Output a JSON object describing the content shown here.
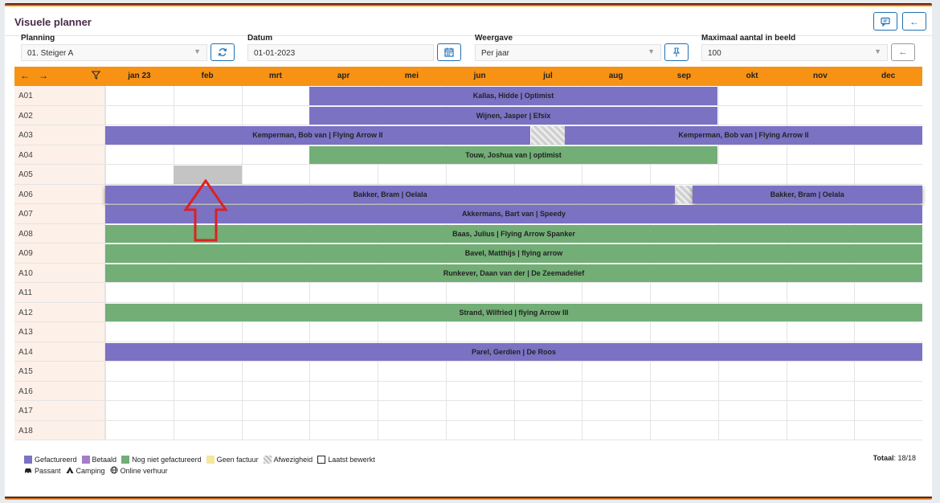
{
  "header": {
    "title": "Visuele planner"
  },
  "filters": {
    "planning": {
      "label": "Planning",
      "value": "01. Steiger A"
    },
    "datum": {
      "label": "Datum",
      "value": "01-01-2023"
    },
    "weergave": {
      "label": "Weergave",
      "value": "Per jaar"
    },
    "max": {
      "label": "Maximaal aantal in beeld",
      "value": "100"
    }
  },
  "months": [
    "jan 23",
    "feb",
    "mrt",
    "apr",
    "mei",
    "jun",
    "jul",
    "aug",
    "sep",
    "okt",
    "nov",
    "dec"
  ],
  "rows": [
    "A01",
    "A02",
    "A03",
    "A04",
    "A05",
    "A06",
    "A07",
    "A08",
    "A09",
    "A10",
    "A11",
    "A12",
    "A13",
    "A14",
    "A15",
    "A16",
    "A17",
    "A18"
  ],
  "bookings": [
    {
      "row": 0,
      "start": 3,
      "end": 9,
      "status": "purple",
      "label": "Kallas, Hidde | Optimist"
    },
    {
      "row": 1,
      "start": 3,
      "end": 9,
      "status": "purple",
      "label": "Wijnen, Jasper | Efsix"
    },
    {
      "row": 2,
      "start": 0,
      "end": 6.25,
      "status": "purple",
      "label": "Kemperman, Bob van | Flying Arrow II"
    },
    {
      "row": 2,
      "start": 6.25,
      "end": 6.75,
      "status": "abs",
      "label": ""
    },
    {
      "row": 2,
      "start": 6.75,
      "end": 12,
      "status": "purple",
      "label": "Kemperman, Bob van | Flying Arrow II"
    },
    {
      "row": 3,
      "start": 3,
      "end": 9,
      "status": "green",
      "label": "Touw, Joshua van | optimist"
    },
    {
      "row": 4,
      "start": 1,
      "end": 2,
      "status": "greyblk",
      "label": ""
    },
    {
      "row": 5,
      "start": 0,
      "end": 8.38,
      "status": "purple",
      "shadow": true,
      "label": "Bakker, Bram | Oelala"
    },
    {
      "row": 5,
      "start": 8.38,
      "end": 8.62,
      "status": "abs",
      "label": ""
    },
    {
      "row": 5,
      "start": 8.62,
      "end": 12,
      "status": "purple",
      "shadow": true,
      "label": "Bakker, Bram | Oelala"
    },
    {
      "row": 6,
      "start": 0,
      "end": 12,
      "status": "purple",
      "label": "Akkermans, Bart van | Speedy"
    },
    {
      "row": 7,
      "start": 0,
      "end": 12,
      "status": "green",
      "label": "Baas, Julius | Flying Arrow Spanker"
    },
    {
      "row": 8,
      "start": 0,
      "end": 12,
      "status": "green",
      "label": "Bavel, Matthijs | flying arrow"
    },
    {
      "row": 9,
      "start": 0,
      "end": 12,
      "status": "green",
      "label": "Runkever, Daan van der | De Zeemadelief"
    },
    {
      "row": 11,
      "start": 0,
      "end": 12,
      "status": "green",
      "label": "Strand, Wilfried | flying Arrow III"
    },
    {
      "row": 13,
      "start": 0,
      "end": 12,
      "status": "purple",
      "label": "Parel, Gerdien | De Roos"
    }
  ],
  "legend": {
    "items": [
      {
        "label": "Gefactureerd",
        "color": "#7b72c4"
      },
      {
        "label": "Betaald",
        "color": "#a67cc8"
      },
      {
        "label": "Nog niet gefactureerd",
        "color": "#72ae76"
      },
      {
        "label": "Geen factuur",
        "color": "#f5e6a0"
      },
      {
        "label": "Afwezigheid",
        "color": "hatch"
      },
      {
        "label": "Laatst bewerkt",
        "color": "outline"
      }
    ],
    "icons": [
      {
        "label": "Passant",
        "icon": "car-icon"
      },
      {
        "label": "Camping",
        "icon": "tent-icon"
      },
      {
        "label": "Online verhuur",
        "icon": "globe-icon"
      }
    ]
  },
  "total": {
    "label": "Totaal",
    "value": ": 18/18"
  }
}
